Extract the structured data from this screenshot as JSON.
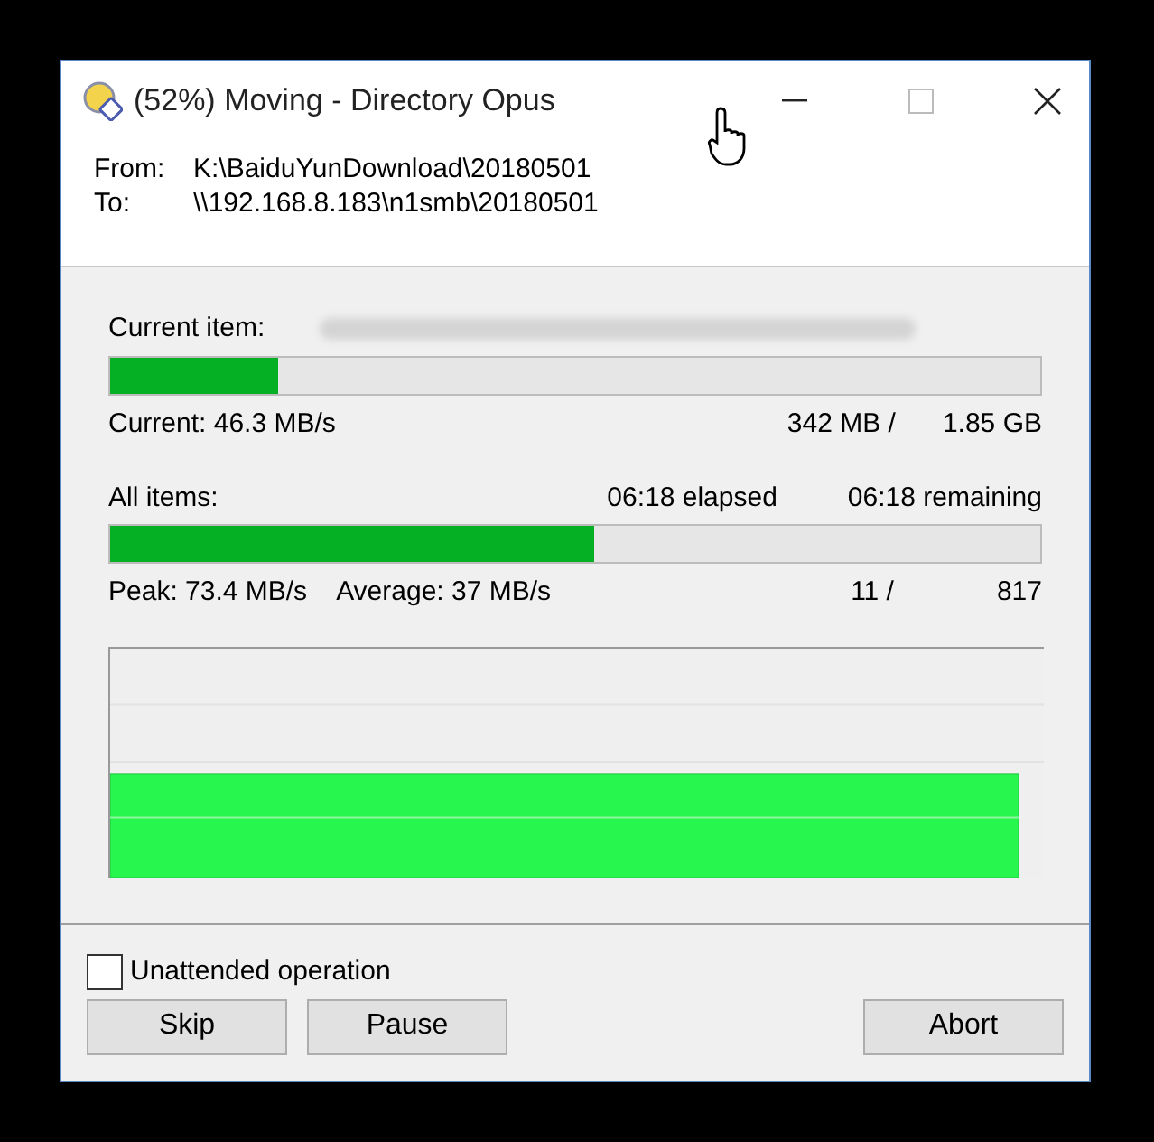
{
  "window": {
    "title": "(52%) Moving - Directory Opus"
  },
  "paths": [
    {
      "label": "From:",
      "value": "K:\\BaiduYunDownload\\20180501"
    },
    {
      "label": "To:",
      "value": "\\\\192.168.8.183\\n1smb\\20180501"
    }
  ],
  "current_item": {
    "label": "Current item:",
    "level": 0.18,
    "speed": "Current: 46.3 MB/s",
    "done": "342 MB /",
    "total": "1.85 GB"
  },
  "all_items": {
    "label": "All items:",
    "elapsed": "06:18 elapsed",
    "remaining": "06:18 remaining",
    "level": 0.52,
    "peak": "Peak: 73.4 MB/s",
    "average": "Average: 37 MB/s",
    "done": "11 /",
    "total": "817"
  },
  "unattended": {
    "label": "Unattended operation",
    "checked": false
  },
  "buttons": [
    {
      "label": "Skip",
      "kind": "left"
    },
    {
      "label": "Pause",
      "kind": "left"
    },
    {
      "label": "Abort",
      "kind": "right"
    }
  ]
}
